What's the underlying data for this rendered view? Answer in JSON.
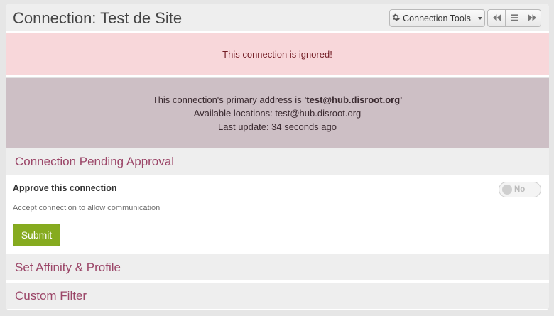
{
  "header": {
    "title": "Connection: Test de Site",
    "tools_label": "Connection Tools",
    "tools_icon": "gear-icon",
    "nav_buttons": [
      "rewind-icon",
      "list-icon",
      "fast-forward-icon"
    ]
  },
  "alert": {
    "text": "This connection is ignored!"
  },
  "info": {
    "primary_prefix": "This connection's primary address is ",
    "primary_address": "'test@hub.disroot.org'",
    "locations": "Available locations: test@hub.disroot.org",
    "last_update": "Last update: 34 seconds ago"
  },
  "approval": {
    "heading": "Connection Pending Approval",
    "label": "Approve this connection",
    "help": "Accept connection to allow communication",
    "toggle_value": "No",
    "submit_label": "Submit"
  },
  "sections": {
    "affinity": "Set Affinity & Profile",
    "filter": "Custom Filter"
  },
  "colors": {
    "alert_bg": "#f8d7da",
    "info_bg": "#cdbfc5",
    "heading_text": "#9b4668",
    "submit_bg": "#86ab1f"
  }
}
